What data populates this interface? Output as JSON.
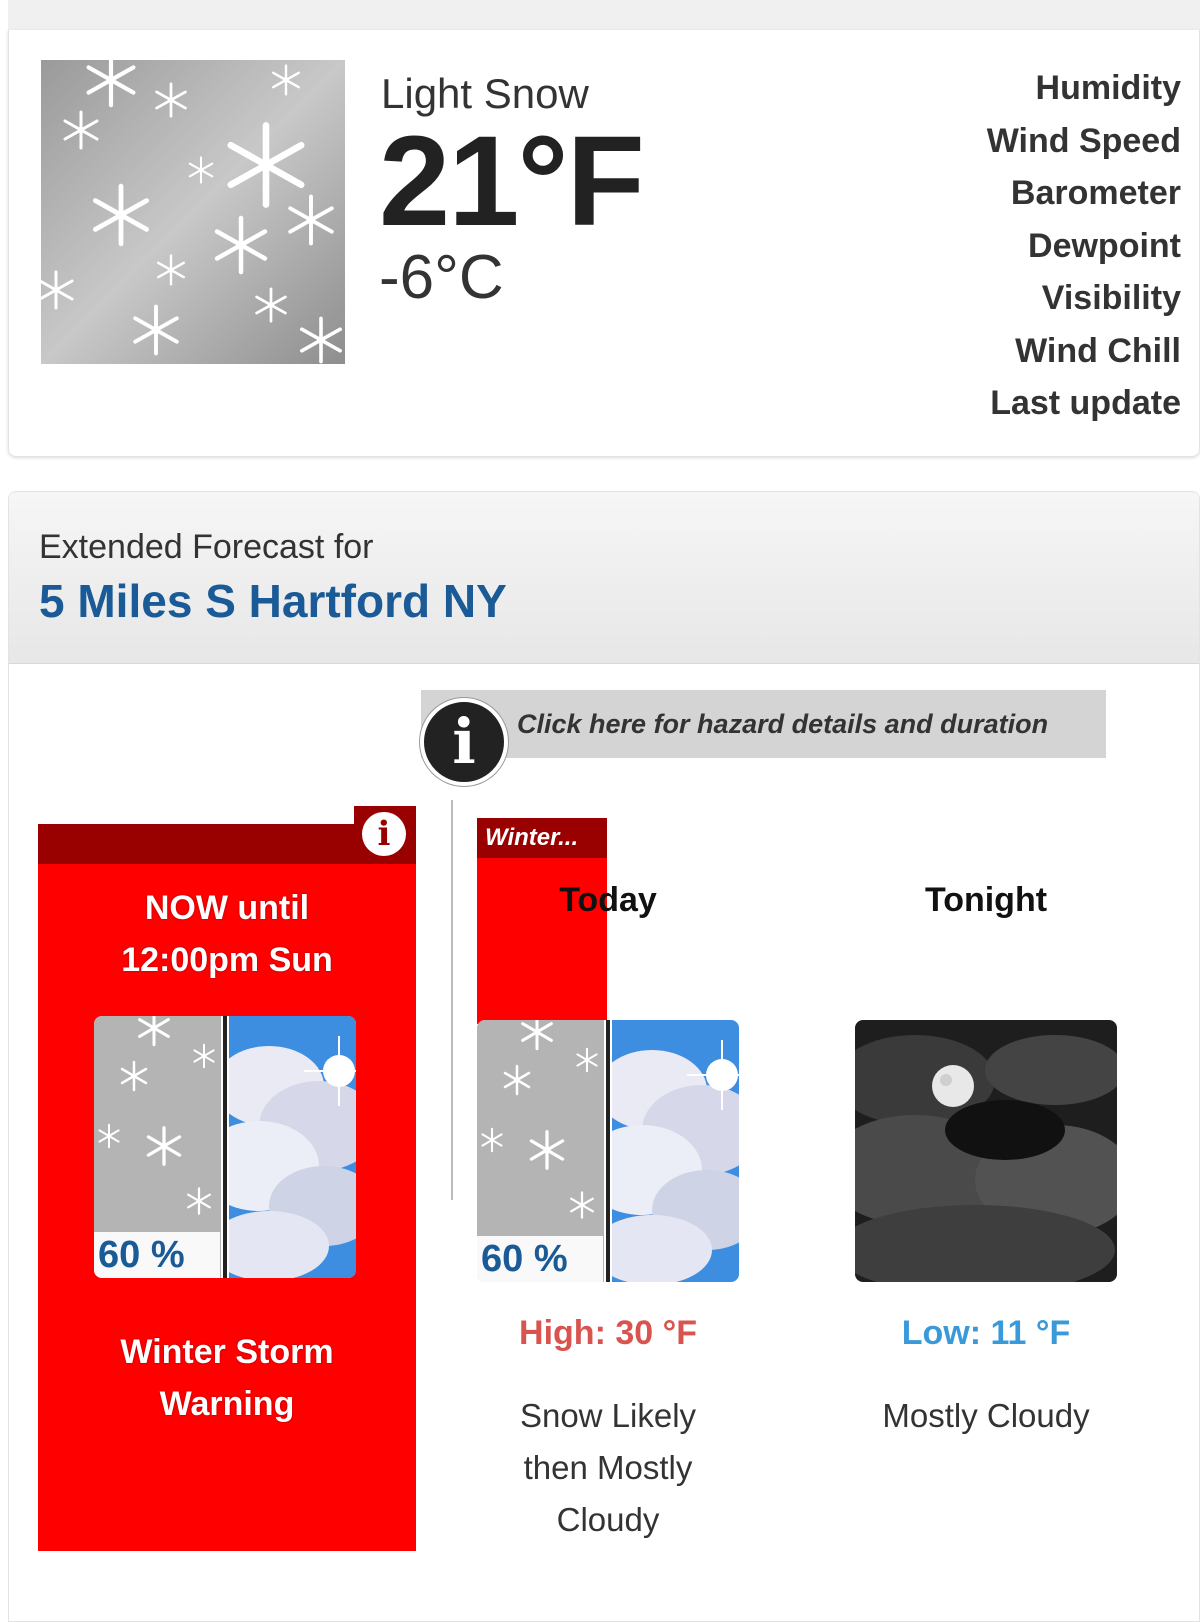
{
  "current": {
    "icon": "light-snow-icon",
    "description": "Light Snow",
    "temp_f": "21°F",
    "temp_c": "-6°C",
    "labels": [
      "Humidity",
      "Wind Speed",
      "Barometer",
      "Dewpoint",
      "Visibility",
      "Wind Chill",
      "Last update"
    ]
  },
  "extended": {
    "label": "Extended Forecast for",
    "location": "5 Miles S Hartford NY",
    "hazard_link": "Click here for hazard details and duration",
    "info_glyph": "i"
  },
  "warning": {
    "when_line1": "NOW until",
    "when_line2": "12:00pm Sun",
    "pop": "60 %",
    "name_line1": "Winter Storm",
    "name_line2": "Warning",
    "color": "#ff0000",
    "dark_color": "#990000"
  },
  "periods": [
    {
      "name": "Today",
      "flag": "Winter...",
      "pop": "60 %",
      "temp": "High: 30 °F",
      "short": [
        "Snow Likely",
        "then Mostly",
        "Cloudy"
      ],
      "icons": [
        "snow-icon",
        "partly-sunny-icon"
      ]
    },
    {
      "name": "Tonight",
      "temp": "Low: 11 °F",
      "short": [
        "Mostly Cloudy"
      ],
      "icons": [
        "night-cloudy-icon"
      ]
    }
  ],
  "colors": {
    "high": "#d9534f",
    "low": "#3a9ad9",
    "location": "#1a5a96"
  }
}
